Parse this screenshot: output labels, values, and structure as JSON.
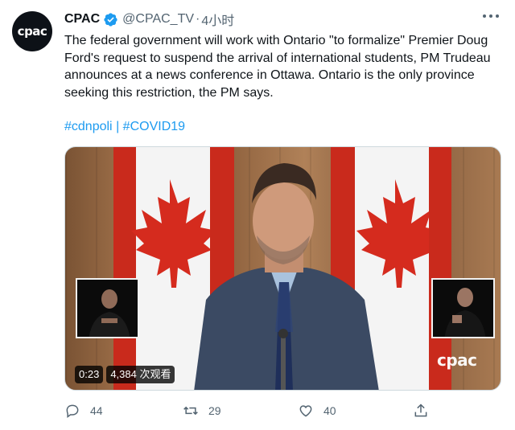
{
  "avatar": {
    "text": "cpac"
  },
  "tweet": {
    "display_name": "CPAC",
    "handle": "@CPAC_TV",
    "separator": "·",
    "time": "4小时",
    "text": "The federal government will work with Ontario \"to formalize\" Premier Doug Ford's request to suspend the arrival of international students, PM Trudeau announces at a news conference in Ottawa. Ontario is the only province seeking this restriction, the PM says.",
    "hashtags": [
      "#cdnpoli",
      "#COVID19"
    ],
    "hashtag_separator": "|"
  },
  "video": {
    "duration": "0:23",
    "views": "4,384 次观看",
    "watermark": "cpac"
  },
  "actions": {
    "reply_count": "44",
    "retweet_count": "29",
    "like_count": "40"
  },
  "icons": {
    "verified": "verified-badge-icon",
    "more": "more-icon",
    "reply": "reply-icon",
    "retweet": "retweet-icon",
    "like": "like-icon",
    "share": "share-icon"
  },
  "colors": {
    "link": "#1d9bf0",
    "muted": "#536471",
    "text": "#0f1419",
    "flag_red": "#d52b1e"
  }
}
